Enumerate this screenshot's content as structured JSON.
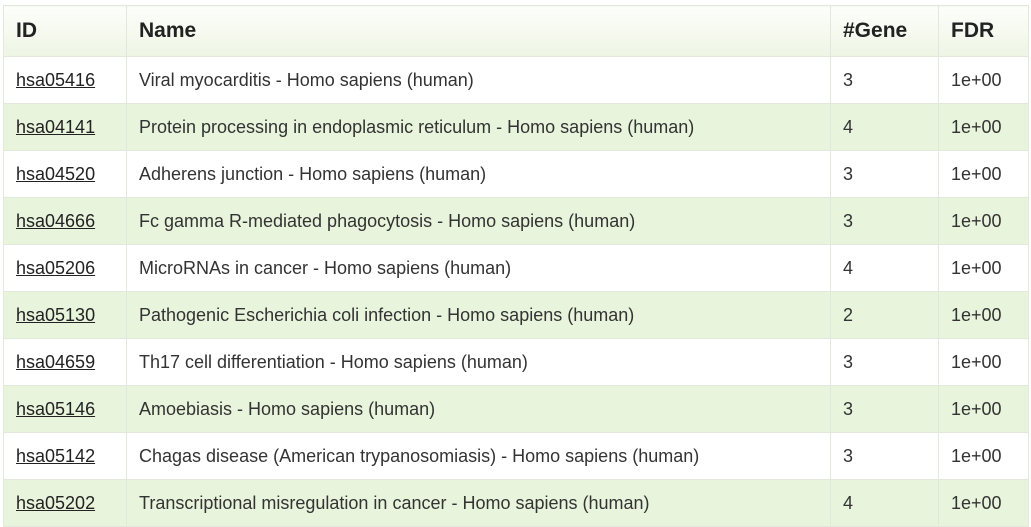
{
  "table": {
    "headers": {
      "id": "ID",
      "name": "Name",
      "gene": "#Gene",
      "fdr": "FDR"
    },
    "rows": [
      {
        "id": "hsa05416",
        "name": "Viral myocarditis - Homo sapiens (human)",
        "gene": "3",
        "fdr": "1e+00"
      },
      {
        "id": "hsa04141",
        "name": "Protein processing in endoplasmic reticulum - Homo sapiens (human)",
        "gene": "4",
        "fdr": "1e+00"
      },
      {
        "id": "hsa04520",
        "name": "Adherens junction - Homo sapiens (human)",
        "gene": "3",
        "fdr": "1e+00"
      },
      {
        "id": "hsa04666",
        "name": "Fc gamma R-mediated phagocytosis - Homo sapiens (human)",
        "gene": "3",
        "fdr": "1e+00"
      },
      {
        "id": "hsa05206",
        "name": "MicroRNAs in cancer - Homo sapiens (human)",
        "gene": "4",
        "fdr": "1e+00"
      },
      {
        "id": "hsa05130",
        "name": "Pathogenic Escherichia coli infection - Homo sapiens (human)",
        "gene": "2",
        "fdr": "1e+00"
      },
      {
        "id": "hsa04659",
        "name": "Th17 cell differentiation - Homo sapiens (human)",
        "gene": "3",
        "fdr": "1e+00"
      },
      {
        "id": "hsa05146",
        "name": "Amoebiasis - Homo sapiens (human)",
        "gene": "3",
        "fdr": "1e+00"
      },
      {
        "id": "hsa05142",
        "name": "Chagas disease (American trypanosomiasis) - Homo sapiens (human)",
        "gene": "3",
        "fdr": "1e+00"
      },
      {
        "id": "hsa05202",
        "name": "Transcriptional misregulation in cancer - Homo sapiens (human)",
        "gene": "4",
        "fdr": "1e+00"
      }
    ]
  },
  "colors": {
    "header_bg": "#eef5e4",
    "row_alt_bg": "#e8f4dc",
    "row_bg": "#ffffff",
    "border": "#e3e8dc",
    "text": "#333333"
  }
}
